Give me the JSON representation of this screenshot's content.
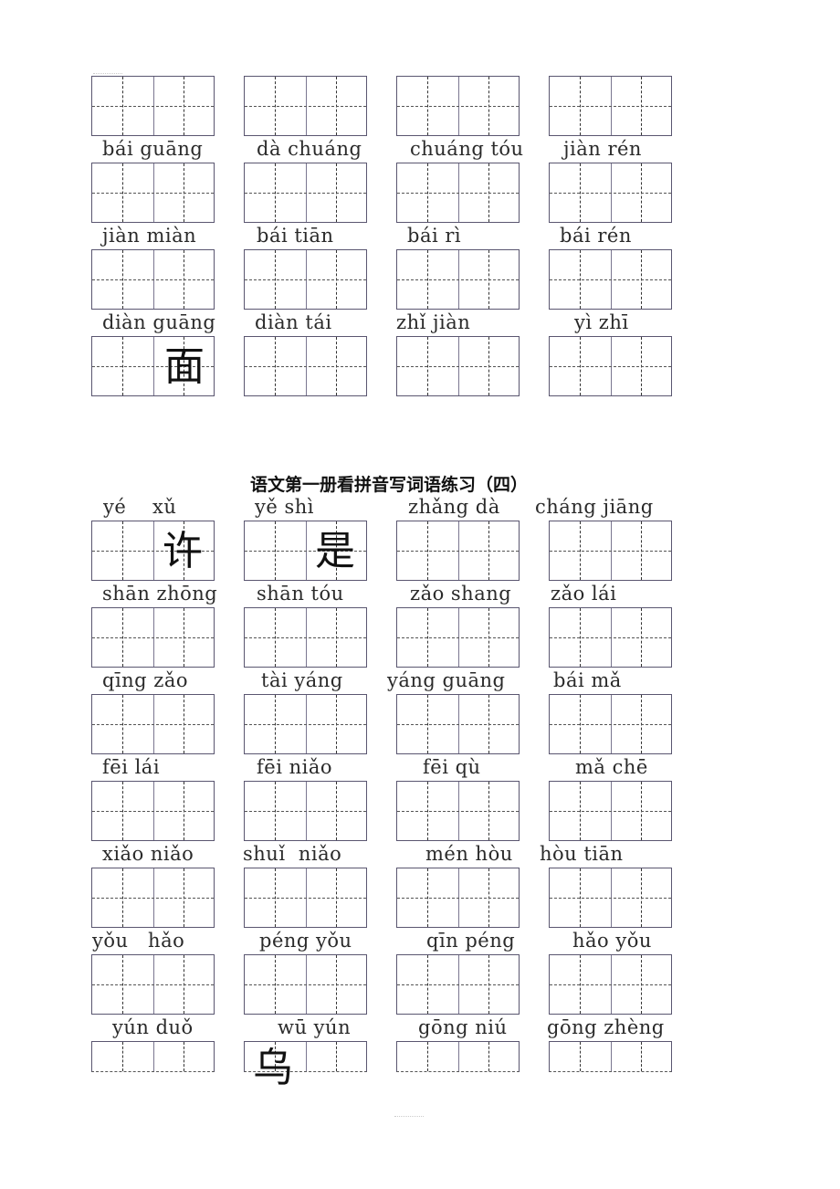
{
  "section1": {
    "rows": [
      {
        "pinyin": [
          "bái guāng",
          "dà chuáng",
          "chuáng tóu",
          "jiàn rén"
        ]
      },
      {
        "pinyin": [
          "jiàn miàn",
          "bái tiān",
          "bái rì",
          "bái rén"
        ]
      },
      {
        "pinyin": [
          "diàn guāng",
          "diàn tái",
          "zhǐ jiàn",
          "yì zhī"
        ]
      }
    ],
    "filled_characters": [
      {
        "row": 2,
        "col": 0,
        "char": "面"
      }
    ]
  },
  "section2": {
    "title": "语文第一册看拼音写词语练习（四）",
    "rows": [
      {
        "pinyin": [
          "yé    xǔ",
          "yě shì",
          "zhǎng dà",
          "cháng jiāng"
        ]
      },
      {
        "pinyin": [
          "shān zhōng",
          "shān tóu",
          "zǎo shang",
          "zǎo lái"
        ]
      },
      {
        "pinyin": [
          "qīng zǎo",
          "tài yáng",
          "yáng guāng",
          "bái mǎ"
        ]
      },
      {
        "pinyin": [
          "fēi lái",
          "fēi niǎo",
          "fēi qù",
          "mǎ chē"
        ]
      },
      {
        "pinyin": [
          "xiǎo niǎo",
          "shuǐ  niǎo",
          "mén hòu",
          "hòu tiān"
        ]
      },
      {
        "pinyin": [
          "yǒu   hǎo",
          "péng yǒu",
          "qīn péng",
          "hǎo yǒu"
        ]
      },
      {
        "pinyin": [
          "yún duǒ",
          "wū yún",
          "gōng niú",
          "gōng zhèng"
        ]
      }
    ],
    "filled_characters": [
      {
        "row": 0,
        "col": 0,
        "char": "许"
      },
      {
        "row": 0,
        "col": 1,
        "char": "是"
      },
      {
        "row": 6,
        "col": 1,
        "char": "乌"
      }
    ]
  }
}
